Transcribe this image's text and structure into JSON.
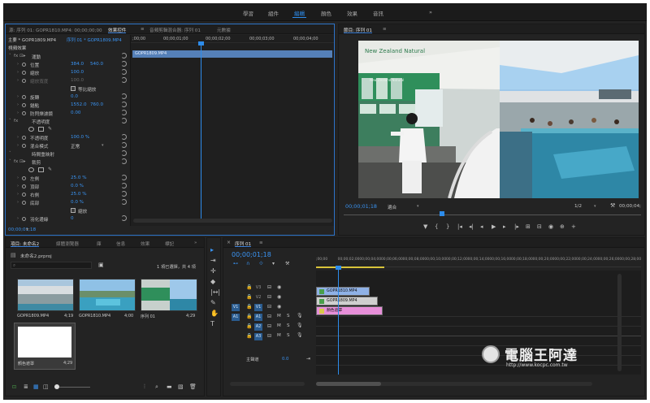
{
  "workspaces": [
    "學習",
    "組件",
    "編輯",
    "顏色",
    "效果",
    "音訊"
  ],
  "workspace_active": 2,
  "workspace_more": "»",
  "effect_controls": {
    "tabs": [
      "源: 序列 01: GOPR1810.MP4: 00;00;00;00",
      "效果控件",
      "音頻剪輯混合器: 序列 01",
      "元數據"
    ],
    "active_tab": 1,
    "menu_icon": "≡",
    "source_label": "主要 * GOPR1809.MP4",
    "sequence_label": "序列 01 * GOPR1809.MP4",
    "ruler_ticks": [
      ";00;00",
      "00;00;01;00",
      "00;00;02;00",
      "00;00;03;00",
      "00;00;04;00"
    ],
    "clip_label": "GOPR1809.MP4",
    "section_video": "視頻效果",
    "rows": [
      {
        "kind": "group",
        "label": "運動",
        "icons": "fx ⊡▸"
      },
      {
        "kind": "prop",
        "label": "位置",
        "v1": "384.0",
        "v2": "540.0"
      },
      {
        "kind": "prop",
        "label": "縮放",
        "v1": "100.0",
        "v2": ""
      },
      {
        "kind": "prop-dim",
        "label": "縮放寬度",
        "v1": "100.0",
        "v2": ""
      },
      {
        "kind": "check",
        "label": "等比縮放"
      },
      {
        "kind": "prop",
        "label": "旋轉",
        "v1": "0.0",
        "v2": ""
      },
      {
        "kind": "prop",
        "label": "錨點",
        "v1": "1552.0",
        "v2": "760.0"
      },
      {
        "kind": "prop",
        "label": "防閃爍濾鏡",
        "v1": "0.00",
        "v2": ""
      },
      {
        "kind": "group",
        "label": "不透明度",
        "icons": "fx"
      },
      {
        "kind": "shapes",
        "label": ""
      },
      {
        "kind": "prop",
        "label": "不透明度",
        "v1": "100.0 %",
        "v2": ""
      },
      {
        "kind": "select",
        "label": "混合模式",
        "v1": "正常",
        "v2": ""
      },
      {
        "kind": "group",
        "label": "時間重映射",
        "icons": ""
      },
      {
        "kind": "group",
        "label": "裁剪",
        "icons": "fx ⊡▸"
      },
      {
        "kind": "shapes",
        "label": ""
      },
      {
        "kind": "prop",
        "label": "左側",
        "v1": "25.0 %",
        "v2": ""
      },
      {
        "kind": "prop",
        "label": "頂部",
        "v1": "0.0 %",
        "v2": ""
      },
      {
        "kind": "prop",
        "label": "右側",
        "v1": "25.0 %",
        "v2": ""
      },
      {
        "kind": "prop",
        "label": "底部",
        "v1": "0.0 %",
        "v2": ""
      },
      {
        "kind": "check",
        "label": "縮放"
      },
      {
        "kind": "prop",
        "label": "羽化邊緣",
        "v1": "0",
        "v2": ""
      }
    ],
    "timecode": "00;00;01;18"
  },
  "program": {
    "tab": "節目: 序列 01",
    "menu_icon": "≡",
    "timecode": "00;00;01;18",
    "fit": "適合",
    "quality": "1/2",
    "duration": "00;00;04;",
    "transport": [
      "▼",
      "{",
      "}",
      "|◂",
      "◂|",
      "◂",
      "▶",
      "▸",
      "|▸",
      "⊞",
      "⊟",
      "◉",
      "⊕",
      "+"
    ],
    "image_sign_1": "New Zealand Natural",
    "image_sign_2": "New Zealand Natural"
  },
  "project": {
    "tabs": [
      "項目: 未命名2",
      "媒體瀏覽器",
      "庫",
      "信息",
      "效果",
      "標記"
    ],
    "active_tab": 0,
    "more": "»",
    "file": "未命名2.prproj",
    "selection": "1 項已選擇，共 4 項",
    "items": [
      {
        "name": "GOPR1809.MP4",
        "dur": "4;19"
      },
      {
        "name": "GOPR1810.MP4",
        "dur": "4;00"
      },
      {
        "name": "序列 01",
        "dur": "4;29"
      },
      {
        "name": "顏色遮罩",
        "dur": "4;29"
      }
    ]
  },
  "tools": [
    "▸",
    "⇥",
    "✛",
    "◆",
    "|↔|",
    "✎",
    "✋",
    "T"
  ],
  "timeline": {
    "tab": "序列 01",
    "menu_icon": "≡",
    "timecode": "00;00;01;18",
    "ruler": [
      ";00;00",
      "00;00;02;00",
      "00;00;04;00",
      "00;00;06;00",
      "00;00;08;00",
      "00;00;10;00",
      "00;00;12;00",
      "00;00;14;00",
      "00;00;16;00",
      "00;00;18;00",
      "00;00;20;00",
      "00;00;22;00",
      "00;00;24;00",
      "00;00;26;00",
      "00;00;28;00"
    ],
    "video_tracks": [
      "V3",
      "V2",
      "V1"
    ],
    "audio_tracks": [
      "A1",
      "A2",
      "A3"
    ],
    "source_v": "V1",
    "source_a": "A1",
    "master": "主聲道",
    "master_value": "0.0",
    "clips": [
      {
        "name": "GOPR1810.MP4",
        "color": "#8fb1e6",
        "track": 0
      },
      {
        "name": "GOPR1809.MP4",
        "color": "#cfcfcf",
        "track": 1
      },
      {
        "name": "顏色遮罩",
        "color": "#e78fd9",
        "track": 2
      }
    ]
  },
  "watermark": {
    "title": "電腦王阿達",
    "url": "http://www.kocpc.com.tw"
  }
}
